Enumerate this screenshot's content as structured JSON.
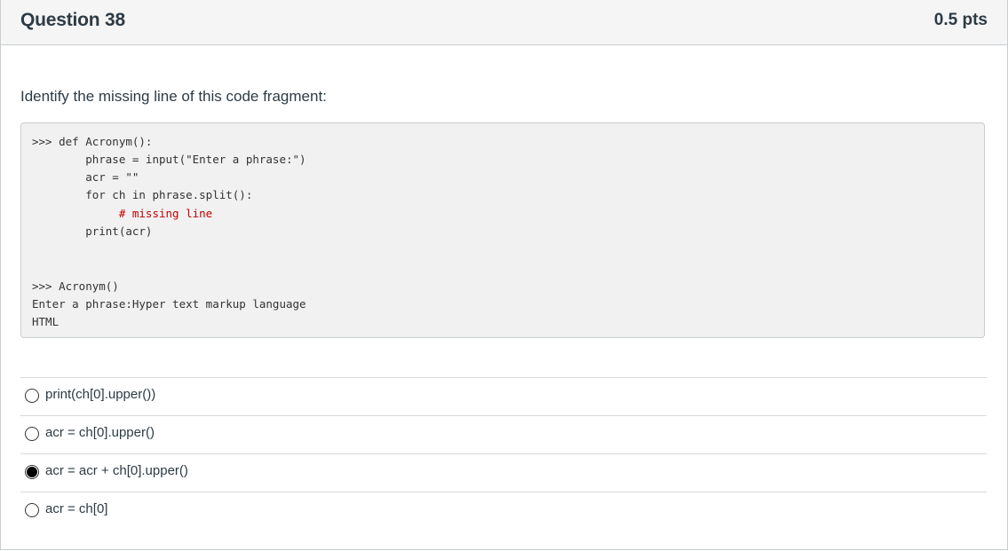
{
  "question": {
    "title": "Question 38",
    "points": "0.5 pts",
    "prompt": "Identify the missing line of this code fragment:"
  },
  "code": {
    "lines": [
      ">>> def Acronym():",
      "        phrase = input(\"Enter a phrase:\")",
      "        acr = \"\"",
      "        for ch in phrase.split():",
      "             # missing line",
      "        print(acr)",
      ">>> Acronym()",
      "Enter a phrase:Hyper text markup language",
      "HTML"
    ]
  },
  "answers": [
    {
      "label": "print(ch[0].upper())",
      "selected": false
    },
    {
      "label": "acr = ch[0].upper()",
      "selected": false
    },
    {
      "label": "acr = acr + ch[0].upper()",
      "selected": true
    },
    {
      "label": "acr = ch[0]",
      "selected": false
    }
  ]
}
